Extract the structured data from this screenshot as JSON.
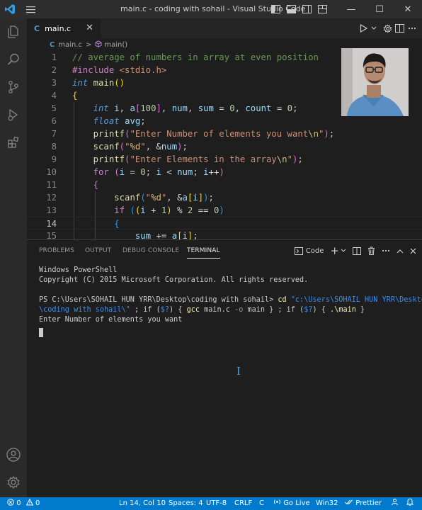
{
  "window": {
    "title": "main.c - coding with sohail - Visual Studio Code",
    "minimize": "—",
    "maximize": "☐",
    "close": "✕"
  },
  "activity": {
    "items": [
      "explorer-icon",
      "search-icon",
      "source-control-icon",
      "run-debug-icon",
      "extensions-icon"
    ],
    "bottom": [
      "accounts-icon",
      "manage-gear-icon"
    ]
  },
  "editor": {
    "tab": {
      "icon_letter": "C",
      "label": "main.c",
      "close": "✕"
    },
    "breadcrumb": {
      "file": "main.c",
      "separator": ">",
      "symbol": "main()"
    },
    "lines": [
      {
        "n": "1"
      },
      {
        "n": "2"
      },
      {
        "n": "3"
      },
      {
        "n": "4"
      },
      {
        "n": "5"
      },
      {
        "n": "6"
      },
      {
        "n": "7"
      },
      {
        "n": "8"
      },
      {
        "n": "9"
      },
      {
        "n": "10"
      },
      {
        "n": "11"
      },
      {
        "n": "12"
      },
      {
        "n": "13"
      },
      {
        "n": "14"
      },
      {
        "n": "15"
      }
    ]
  },
  "panel": {
    "tabs": [
      "PROBLEMS",
      "OUTPUT",
      "DEBUG CONSOLE",
      "TERMINAL"
    ],
    "active_tab": "TERMINAL",
    "terminal_name": "Code",
    "terminal_lines": {
      "l1": "Windows PowerShell",
      "l2": "Copyright (C) 2015 Microsoft Corporation. All rights reserved.",
      "l4_prompt": "PS C:\\Users\\SOHAIL HUN YRR\\Desktop\\coding with sohail> ",
      "l4_cd": "cd ",
      "l4_path1": "\"c:\\Users\\SOHAIL HUN YRR\\Desktop",
      "l5_path2": "\\coding with sohail\\\"",
      "l5_a": " ; if (",
      "l5_var1": "$?",
      "l5_b": ") { ",
      "l5_gcc": "gcc",
      "l5_c": " main.c ",
      "l5_o": "-o",
      "l5_d": " main } ; if (",
      "l5_var2": "$?",
      "l5_e": ") { ",
      "l5_run": ".\\main",
      "l5_f": " }",
      "l6": "Enter Number of elements you want"
    },
    "cursor_glyph": "I"
  },
  "status": {
    "errors": "0",
    "warnings": "0",
    "position": "Ln 14, Col 10",
    "spaces": "Spaces: 4",
    "encoding": "UTF-8",
    "eol": "CRLF",
    "language": "C",
    "go_live": "Go Live",
    "platform": "Win32",
    "prettier": "Prettier"
  },
  "colors": {
    "accent": "#007acc",
    "editor_bg": "#1e1e1e",
    "titlebar_bg": "#2d2d2d"
  }
}
